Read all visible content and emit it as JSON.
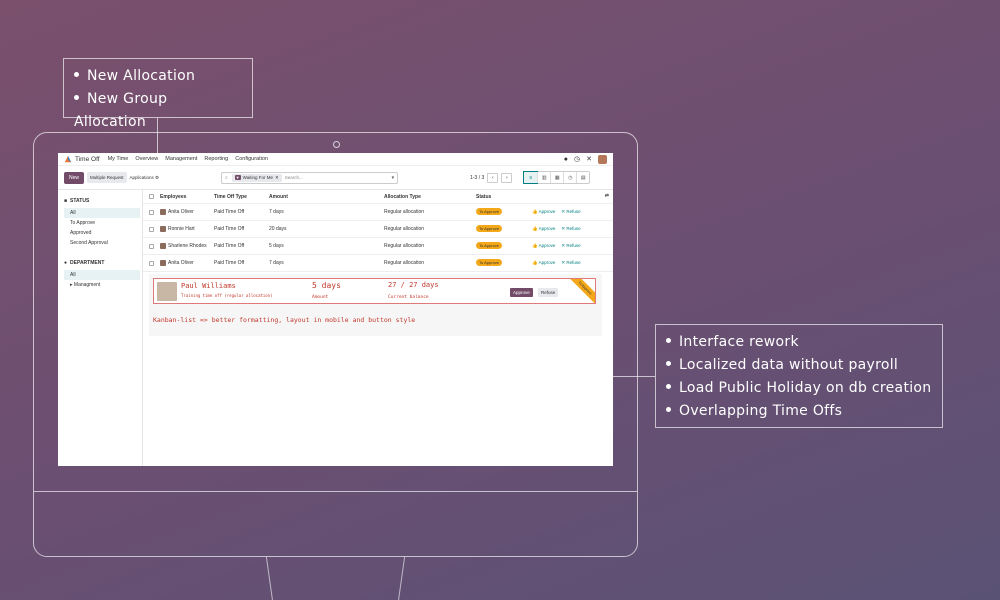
{
  "callouts": {
    "top": [
      "New Allocation",
      "New Group Allocation"
    ],
    "right": [
      "Interface rework",
      "Localized data without payroll",
      "Load Public Holiday on db creation",
      "Overlapping Time Offs"
    ]
  },
  "topbar": {
    "app_name": "Time Off",
    "menu": [
      "My Time",
      "Overview",
      "Management",
      "Reporting",
      "Configuration"
    ]
  },
  "controlbar": {
    "new_label": "New",
    "multiple_label": "Multiple Request",
    "tab_label": "Applications ⚙",
    "search_facet": "Waiting For Me",
    "search_placeholder": "Search...",
    "pager": "1-3 / 3"
  },
  "sidebar": {
    "status_title": "STATUS",
    "status_items": [
      "All",
      "To Approve",
      "Approved",
      "Second Approval"
    ],
    "department_title": "DEPARTMENT",
    "department_items": [
      "All",
      "▸ Managment"
    ]
  },
  "table": {
    "headers": [
      "Employees",
      "Time Off Type",
      "Amount",
      "Allocation Type",
      "Status"
    ],
    "rows": [
      {
        "employee": "Anita Oliver",
        "type": "Paid Time Off",
        "amount": "7 days",
        "alloc": "Regular allocation",
        "status": "To Approve",
        "approve": "Approve",
        "refuse": "Refuse"
      },
      {
        "employee": "Ronnie Hart",
        "type": "Paid Time Off",
        "amount": "20 days",
        "alloc": "Regular allocation",
        "status": "To Approve",
        "approve": "Approve",
        "refuse": "Refuse"
      },
      {
        "employee": "Sharlene Rhodes",
        "type": "Paid Time Off",
        "amount": "5 days",
        "alloc": "Regular allocation",
        "status": "To Approve",
        "approve": "Approve",
        "refuse": "Refuse"
      },
      {
        "employee": "Anita Oliver",
        "type": "Paid Time Off",
        "amount": "7 days",
        "alloc": "Regular allocation",
        "status": "To Approve",
        "approve": "Approve",
        "refuse": "Refuse"
      }
    ]
  },
  "kanban": {
    "name": "Paul Williams",
    "subtitle": "Training time off (regular allocation)",
    "amount": "5 days",
    "amount_label": "Amount",
    "balance": "27 / 27 days",
    "balance_label": "Current balance",
    "approve": "Approve",
    "refuse": "Refuse",
    "ribbon": "To Approve",
    "note": "Kanban-list => better formatting, layout in mobile and button style"
  },
  "colors": {
    "accent": "#714b67",
    "teal": "#017e84",
    "badge": "#f3a81a"
  }
}
